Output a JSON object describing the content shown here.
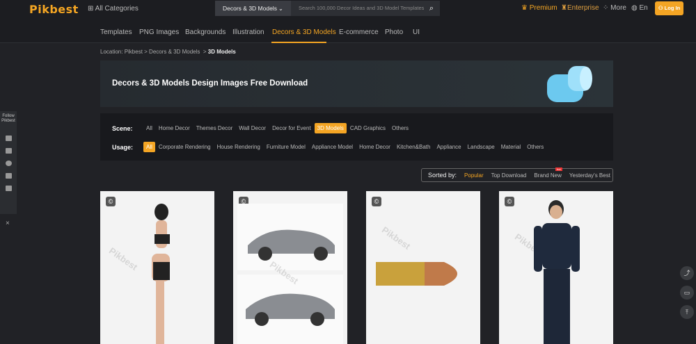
{
  "header": {
    "logo": "Pikbest",
    "all_categories": "All Categories",
    "search_category": "Decors & 3D Models",
    "search_placeholder": "Search 100,000 Decor Ideas and 3D Model Templates",
    "premium": "Premium",
    "enterprise": "Enterprise",
    "more": "More",
    "language": "En",
    "login": "Log In"
  },
  "nav": [
    {
      "label": "Templates"
    },
    {
      "label": "PNG Images"
    },
    {
      "label": "Backgrounds"
    },
    {
      "label": "Illustration"
    },
    {
      "label": "Decors & 3D Models"
    },
    {
      "label": "E-commerce"
    },
    {
      "label": "Photo"
    },
    {
      "label": "UI"
    }
  ],
  "breadcrumb": {
    "prefix": "Location: Pikbest > Decors & 3D Models",
    "sep": ">",
    "current": "3D Models"
  },
  "banner": {
    "title": "Decors & 3D Models Design Images Free Download"
  },
  "filters": {
    "scene_label": "Scene:",
    "scene": [
      "All",
      "Home Decor",
      "Themes Decor",
      "Wall Decor",
      "Decor for Event",
      "3D Models",
      "CAD Graphics",
      "Others"
    ],
    "usage_label": "Usage:",
    "usage": [
      "All",
      "Corporate Rendering",
      "House Rendering",
      "Furniture Model",
      "Appliance Model",
      "Home Decor",
      "Kitchen&Bath",
      "Appliance",
      "Landscape",
      "Material",
      "Others"
    ]
  },
  "sort": {
    "label": "Sorted by:",
    "options": [
      "Popular",
      "Top Download",
      "Brand New",
      "Yesterday's Best"
    ],
    "hot_badge": "hot"
  },
  "sidebar": {
    "follow": "Follow Pikbest",
    "close": "×"
  },
  "cards": [
    {
      "title": "woman model",
      "watermark": "Pikbest"
    },
    {
      "title": "sports car",
      "watermark": "Pikbest"
    },
    {
      "title": "bullet",
      "watermark": "Pikbest"
    },
    {
      "title": "police officer",
      "watermark": "Pikbest"
    }
  ]
}
